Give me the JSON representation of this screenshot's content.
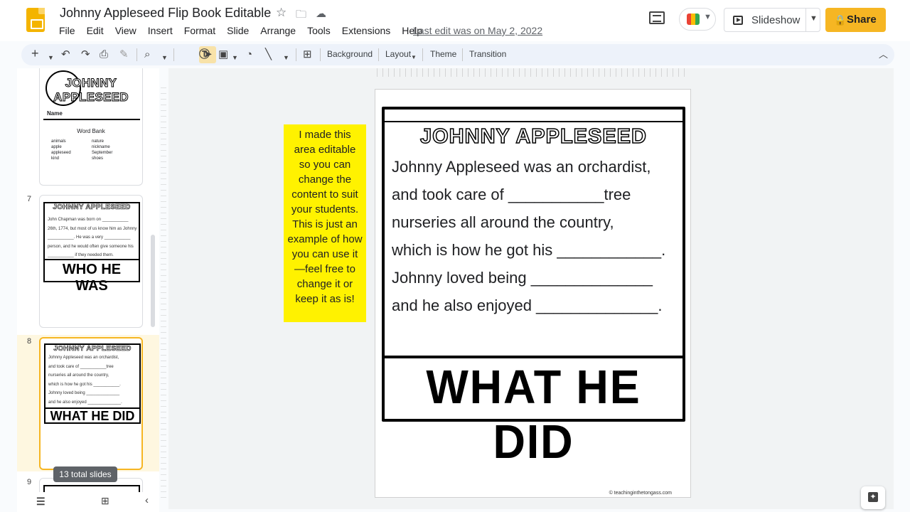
{
  "header": {
    "title": "Johnny Appleseed Flip Book Editable",
    "menu": [
      "File",
      "Edit",
      "View",
      "Insert",
      "Format",
      "Slide",
      "Arrange",
      "Tools",
      "Extensions",
      "Help"
    ],
    "last_edit": "Last edit was on May 2, 2022",
    "slideshow_label": "Slideshow",
    "share_label": "Share"
  },
  "toolbar": {
    "background_label": "Background",
    "layout_label": "Layout",
    "theme_label": "Theme",
    "transition_label": "Transition"
  },
  "filmstrip": {
    "thumb6": {
      "title": "JOHNNY APPLESEED",
      "name_label": "Name",
      "word_bank_title": "Word Bank",
      "words_left": [
        "animals",
        "apple",
        "appleseed",
        "kind"
      ],
      "words_right": [
        "nature",
        "nickname",
        "September",
        "shoes"
      ]
    },
    "thumb7": {
      "number": "7",
      "title": "JOHNNY APPLESEED",
      "lines": [
        "John Chapman was born on ___________",
        "26th, 1774, but most of us know him as Johnny",
        "___________. He was a very ___________",
        "person, and he would often give someone his",
        "___________ if they needed them."
      ],
      "big": "WHO HE WAS"
    },
    "thumb8": {
      "number": "8",
      "title": "JOHNNY APPLESEED",
      "lines": [
        "Johnny Appleseed was an orchardist,",
        "and took care of ___________tree",
        "nurseries all around the country,",
        "which is how he got his ___________.",
        "Johnny loved being ______________",
        "and he also enjoyed ______________."
      ],
      "big": "WHAT HE DID"
    },
    "thumb9_number": "9",
    "total_slides": "13 total slides"
  },
  "sticky_note": "I made this area editable so you can change the content to suit your students. This is just an example of how you can use it—feel free to change it or keep it as is!",
  "slide": {
    "title": "JOHNNY APPLESEED",
    "lines": [
      "Johnny Appleseed was an orchardist,",
      "and took care of ___________tree",
      "nurseries all around the country,",
      "which is how he got his ____________.",
      "Johnny loved being ______________",
      "and he also enjoyed ______________."
    ],
    "big": "WHAT HE DID",
    "credit": "© teachinginthetongass.com"
  },
  "colors": {
    "share": "#f6b623",
    "sticky": "#fff200",
    "toolbar": "#edf2fa",
    "logo": "#f4b400"
  }
}
